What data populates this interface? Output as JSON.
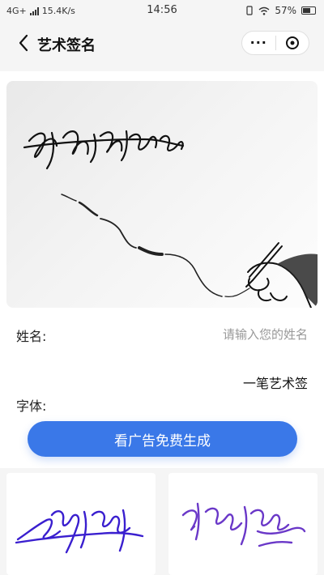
{
  "status_bar": {
    "network": "4G+",
    "speed": "15.4K/s",
    "time": "14:56",
    "battery": "57%"
  },
  "nav": {
    "title": "艺术签名",
    "more_label": "···"
  },
  "form": {
    "name_label": "姓名:",
    "name_placeholder": "请输入您的姓名",
    "font_label": "字体:",
    "font_value": "一笔艺术签"
  },
  "generate_button": "看广告免费生成",
  "colors": {
    "accent": "#3a78e8",
    "sample_ink_1": "#3a1fcf",
    "sample_ink_2": "#6a38c8"
  },
  "icons": [
    "back-icon",
    "more-icon",
    "close-circle-icon",
    "wifi-icon",
    "battery-icon"
  ]
}
